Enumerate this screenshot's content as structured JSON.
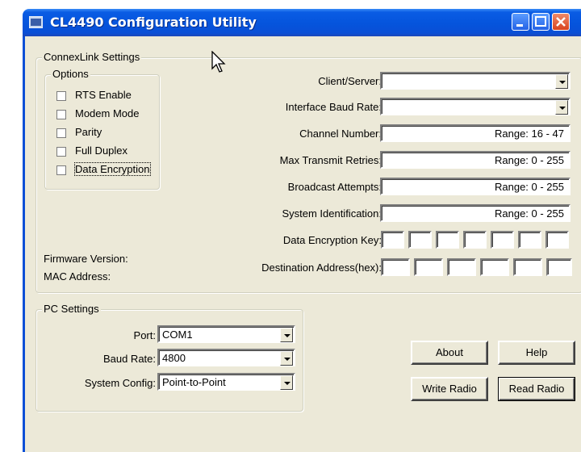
{
  "window": {
    "title": "CL4490 Configuration Utility"
  },
  "connex": {
    "group_title": "ConnexLink Settings",
    "options_title": "Options",
    "options": [
      {
        "label": "RTS Enable",
        "checked": false
      },
      {
        "label": "Modem Mode",
        "checked": false
      },
      {
        "label": "Parity",
        "checked": false
      },
      {
        "label": "Full Duplex",
        "checked": false
      },
      {
        "label": "Data Encryption",
        "checked": false
      }
    ],
    "firmware_label": "Firmware Version:",
    "mac_label": "MAC Address:",
    "fields": {
      "client_server": {
        "label": "Client/Server:",
        "value": ""
      },
      "baud": {
        "label": "Interface Baud Rate:",
        "value": ""
      },
      "channel": {
        "label": "Channel Number:",
        "range": "Range: 16 - 47"
      },
      "retries": {
        "label": "Max Transmit Retries:",
        "range": "Range: 0 - 255"
      },
      "broadcast": {
        "label": "Broadcast Attempts:",
        "range": "Range: 0 - 255"
      },
      "sysid": {
        "label": "System Identification:",
        "range": "Range: 0 - 255"
      },
      "enc_key": {
        "label": "Data Encryption Key:"
      },
      "dest_addr": {
        "label": "Destination Address(hex):"
      }
    }
  },
  "pc": {
    "group_title": "PC Settings",
    "port": {
      "label": "Port:",
      "value": "COM1"
    },
    "baud": {
      "label": "Baud Rate:",
      "value": "4800"
    },
    "sysconfig": {
      "label": "System Config:",
      "value": "Point-to-Point"
    }
  },
  "buttons": {
    "about": "About",
    "help": "Help",
    "write": "Write Radio",
    "read": "Read Radio"
  },
  "colors": {
    "titlebar": "#0554dc",
    "client_bg": "#ece9d8"
  }
}
